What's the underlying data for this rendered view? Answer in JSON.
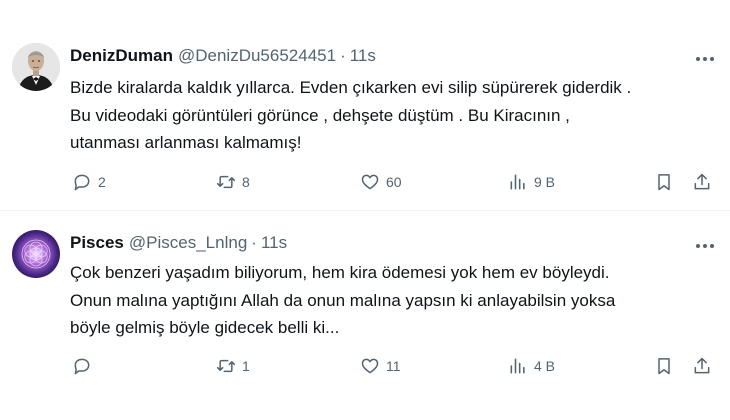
{
  "tweets": [
    {
      "name": "DenizDuman",
      "handle": "@DenizDu56524451",
      "separator": "·",
      "time": "11s",
      "lines": [
        "Bizde kiralarda kaldık yıllarca. Evden çıkarken evi silip süpürerek giderdik .",
        "Bu videodaki görüntüleri görünce ,  dehşete düştüm . Bu Kiracının ,",
        "utanması arlanması  kalmamış!"
      ],
      "replies": "2",
      "reposts": "8",
      "likes": "60",
      "views": "9 B"
    },
    {
      "name": "Pisces",
      "handle": "@Pisces_Lnlng",
      "separator": "·",
      "time": "11s",
      "lines": [
        "Çok benzeri yaşadım biliyorum, hem kira ödemesi yok hem ev böyleydi.",
        "Onun malına yaptığını Allah da onun malına yapsın ki anlayabilsin yoksa",
        "böyle gelmiş böyle gidecek belli ki..."
      ],
      "replies": "",
      "reposts": "1",
      "likes": "11",
      "views": "4 B"
    }
  ],
  "icons": [
    "reply-icon",
    "repost-icon",
    "like-icon",
    "views-icon",
    "bookmark-icon",
    "share-icon",
    "more-icon"
  ],
  "colors": {
    "text": "#0f1419",
    "muted": "#536471",
    "divider": "#eff3f4"
  }
}
